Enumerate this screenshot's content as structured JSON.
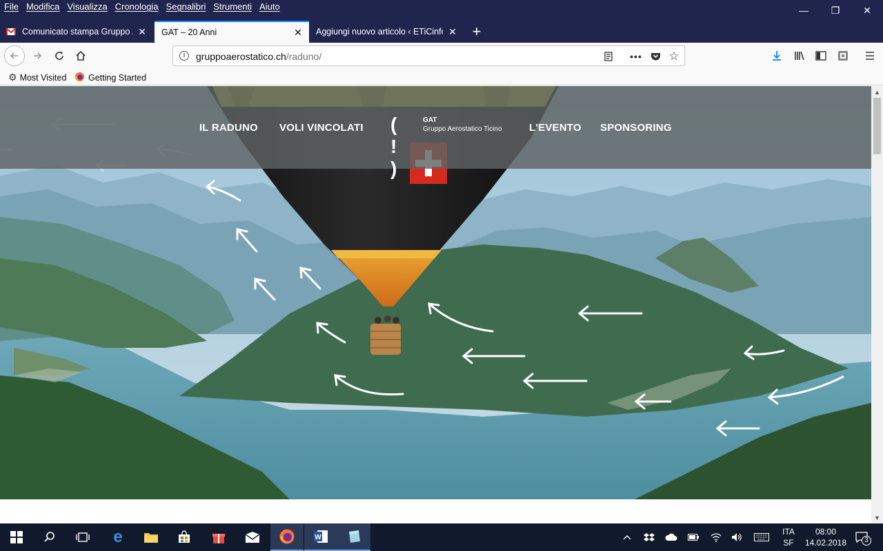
{
  "menubar": {
    "items": [
      "File",
      "Modifica",
      "Visualizza",
      "Cronologia",
      "Segnalibri",
      "Strumenti",
      "Aiuto"
    ]
  },
  "tabs": [
    {
      "title": "Comunicato stampa Gruppo Ae",
      "icon": "gmail-icon",
      "active": false
    },
    {
      "title": "GAT – 20 Anni",
      "icon": "",
      "active": true
    },
    {
      "title": "Aggiungi nuovo articolo ‹ ETiCinfo",
      "icon": "",
      "active": false
    }
  ],
  "navbar": {
    "url_host": "gruppoaerostatico.ch",
    "url_path": "/raduno/"
  },
  "bookmarks": [
    {
      "label": "Most Visited",
      "icon": "gear-icon"
    },
    {
      "label": "Getting Started",
      "icon": "firefox-icon"
    }
  ],
  "site": {
    "nav_left": [
      "IL RADUNO",
      "VOLI VINCOLATI"
    ],
    "nav_right": [
      "L'EVENTO",
      "SPONSORING"
    ],
    "logo_mark": "( ! )",
    "logo_name": "GAT",
    "logo_sub": "Gruppo Aerostatico Ticino"
  },
  "taskbar": {
    "lang_top": "ITA",
    "lang_bottom": "SF",
    "time": "08:00",
    "date": "14.02.2018",
    "notifications": "3"
  }
}
